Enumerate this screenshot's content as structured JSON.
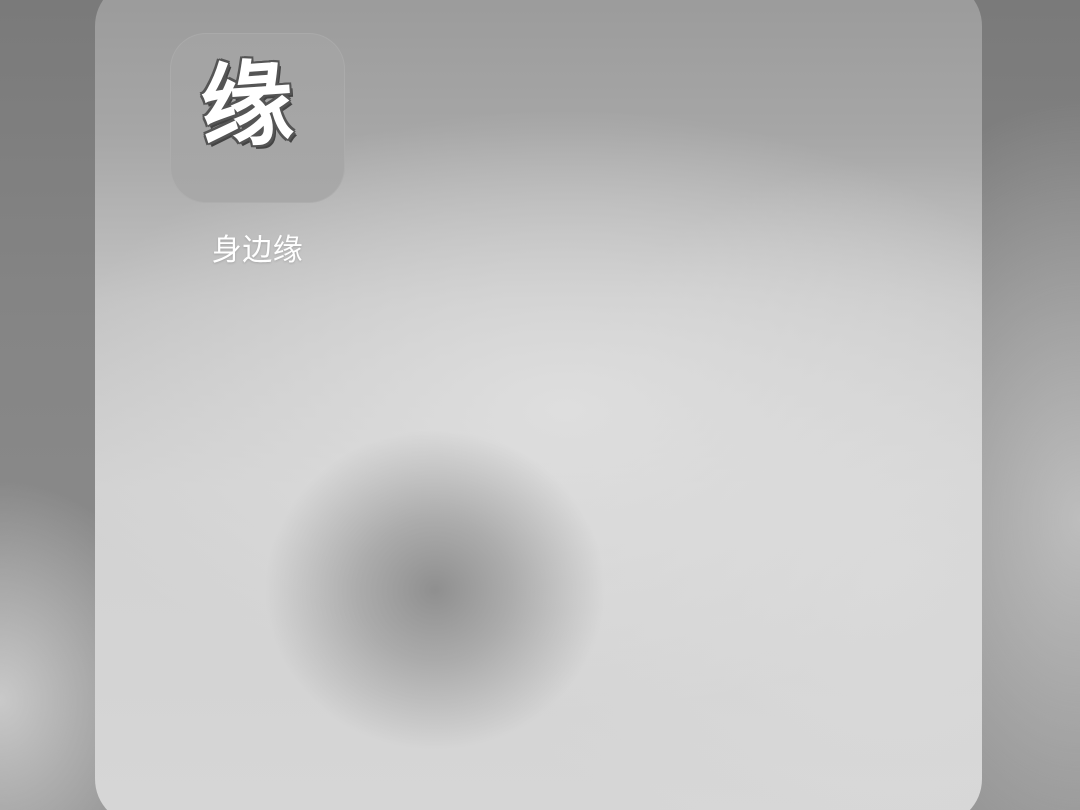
{
  "folder": {
    "apps": [
      {
        "icon_text": "缘",
        "label": "身边缘",
        "icon": "app-icon-yuan"
      }
    ]
  },
  "colors": {
    "label_text": "#ffffff",
    "icon_glyph": "#ffffff",
    "icon_tile": "#a6a6a6"
  }
}
